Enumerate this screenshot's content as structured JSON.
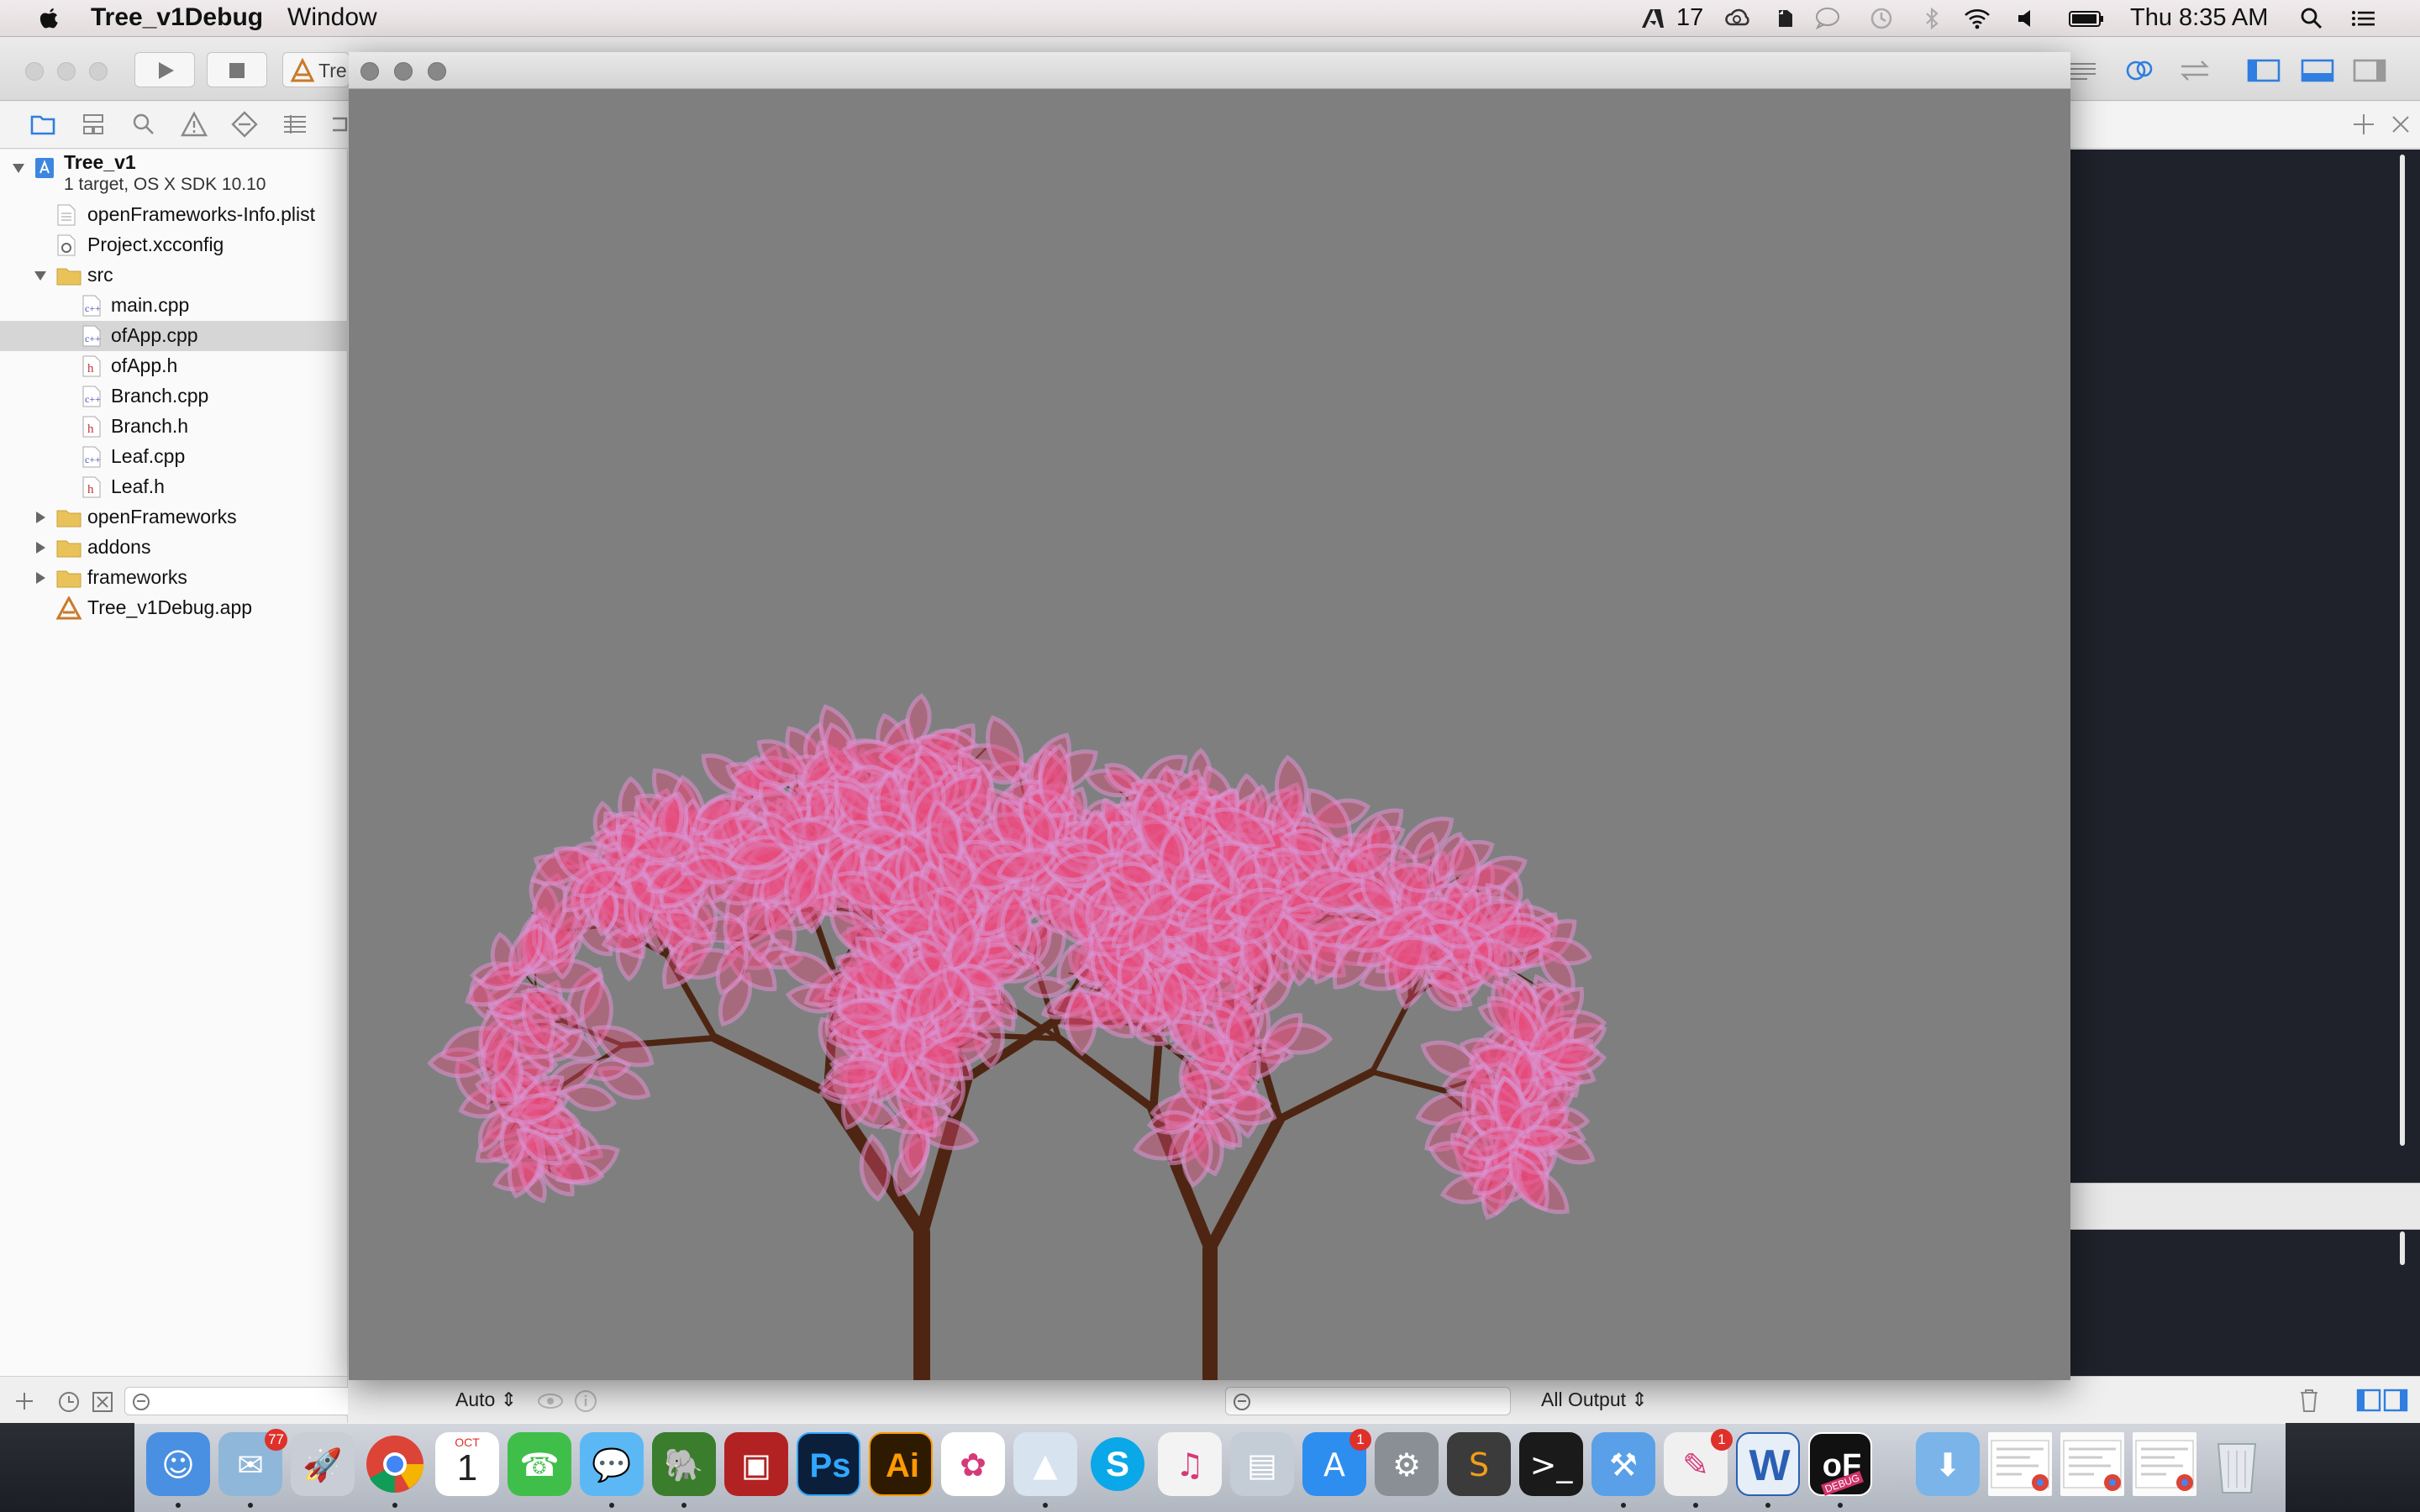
{
  "menubar": {
    "app_name": "Tree_v1Debug",
    "menus": [
      "Window"
    ],
    "clock": "Thu 8:35 AM",
    "adobe_count": "17",
    "status_icons": [
      "adobe-icon",
      "creative-cloud-icon",
      "evernote-icon",
      "messages-icon",
      "time-machine-icon",
      "bluetooth-icon",
      "wifi-icon",
      "volume-icon",
      "battery-icon",
      "spotlight-icon",
      "notification-center-icon"
    ]
  },
  "toolbar": {
    "scheme_label": "Tre"
  },
  "navigator": {
    "project": {
      "name": "Tree_v1",
      "subtitle": "1 target, OS X SDK 10.10"
    },
    "items": [
      {
        "label": "openFrameworks-Info.plist",
        "type": "plist"
      },
      {
        "label": "Project.xcconfig",
        "type": "xcconfig"
      },
      {
        "label": "src",
        "type": "folder",
        "expanded": true
      },
      {
        "label": "main.cpp",
        "type": "cpp"
      },
      {
        "label": "ofApp.cpp",
        "type": "cpp",
        "selected": true
      },
      {
        "label": "ofApp.h",
        "type": "h"
      },
      {
        "label": "Branch.cpp",
        "type": "cpp"
      },
      {
        "label": "Branch.h",
        "type": "h"
      },
      {
        "label": "Leaf.cpp",
        "type": "cpp"
      },
      {
        "label": "Leaf.h",
        "type": "h"
      },
      {
        "label": "openFrameworks",
        "type": "folder",
        "expanded": false
      },
      {
        "label": "addons",
        "type": "folder",
        "expanded": false
      },
      {
        "label": "frameworks",
        "type": "folder",
        "expanded": false
      },
      {
        "label": "Tree_v1Debug.app",
        "type": "app"
      }
    ]
  },
  "debug_area": {
    "variables_mode": "Auto",
    "output_mode": "All Output"
  },
  "dock": {
    "items": [
      {
        "name": "finder",
        "running": true
      },
      {
        "name": "mail",
        "badge": "77",
        "running": true
      },
      {
        "name": "launchpad"
      },
      {
        "name": "chrome",
        "running": true
      },
      {
        "name": "calendar",
        "month": "OCT",
        "day": "1"
      },
      {
        "name": "facetime"
      },
      {
        "name": "messages",
        "running": true
      },
      {
        "name": "evernote",
        "running": true
      },
      {
        "name": "photo-booth"
      },
      {
        "name": "photoshop",
        "glyph": "Ps"
      },
      {
        "name": "illustrator",
        "glyph": "Ai"
      },
      {
        "name": "photos"
      },
      {
        "name": "keynote",
        "running": true
      },
      {
        "name": "skype"
      },
      {
        "name": "itunes"
      },
      {
        "name": "preview"
      },
      {
        "name": "app-store",
        "badge": "1"
      },
      {
        "name": "system-preferences"
      },
      {
        "name": "sublime-text"
      },
      {
        "name": "terminal"
      },
      {
        "name": "xcode",
        "running": true
      },
      {
        "name": "pixelmator",
        "badge": "1",
        "running": true
      },
      {
        "name": "word",
        "glyph": "W",
        "running": true
      },
      {
        "name": "openframeworks-debug",
        "glyph": "oF",
        "sub_label": "DEBUG",
        "running": true
      },
      {
        "name": "downloads-folder"
      },
      {
        "name": "chrome-window-1"
      },
      {
        "name": "chrome-window-2"
      },
      {
        "name": "chrome-window-3"
      },
      {
        "name": "trash"
      }
    ]
  },
  "colors": {
    "canvas_bg": "#7f7f7f",
    "branch": "#4e2512",
    "leaf": "#e8497a",
    "leaf_rim": "#d995d4",
    "editor_bg": "#1f222b"
  }
}
